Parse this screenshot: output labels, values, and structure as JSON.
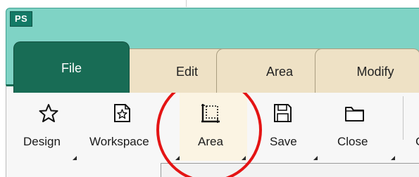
{
  "app": {
    "badge": "PS"
  },
  "tabs": [
    {
      "label": "File",
      "active": true
    },
    {
      "label": "Edit",
      "active": false
    },
    {
      "label": "Area",
      "active": false
    },
    {
      "label": "Modify",
      "active": false
    }
  ],
  "ribbon": {
    "buttons": [
      {
        "label": "Design",
        "icon": "star-icon"
      },
      {
        "label": "Workspace",
        "icon": "document-star-icon"
      },
      {
        "label": "Area",
        "icon": "area-select-icon",
        "highlighted": true
      },
      {
        "label": "Save",
        "icon": "save-disk-icon"
      },
      {
        "label": "Close",
        "icon": "folder-icon"
      }
    ],
    "partial_label": "C"
  },
  "colors": {
    "window_frame": "#7fd3c5",
    "active_tab": "#186c55",
    "inactive_tab": "#eee1c5",
    "highlight_ring": "#e41414"
  }
}
